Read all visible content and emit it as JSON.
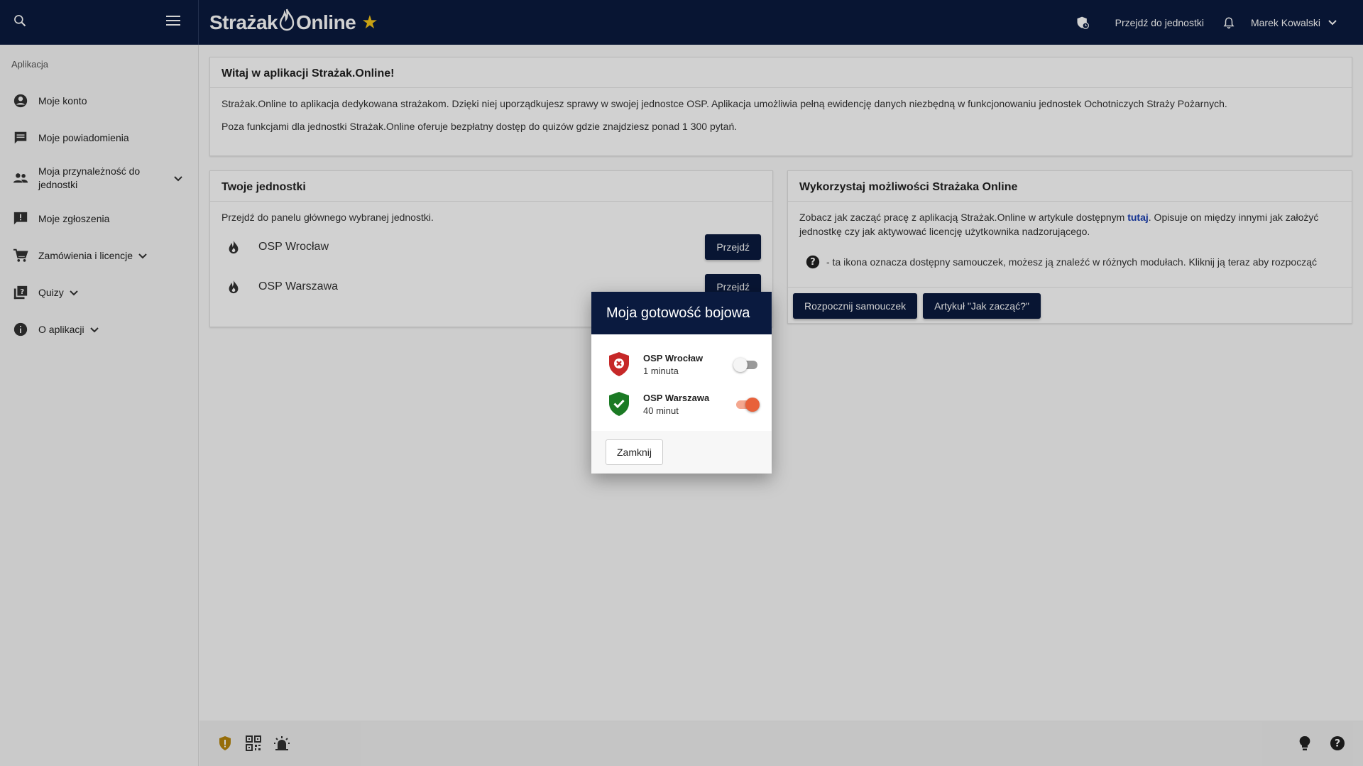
{
  "topbar": {
    "brand_left": "Strażak",
    "brand_right": "Online",
    "link_label": "Przejdź do jednostki",
    "user_name": "Marek Kowalski"
  },
  "sidebar": {
    "header": "Aplikacja",
    "items": [
      {
        "label": "Moje konto",
        "icon": "account-circle-icon"
      },
      {
        "label": "Moje powiadomienia",
        "icon": "message-icon"
      },
      {
        "label": "Moja przynależność do jednostki",
        "icon": "group-icon"
      },
      {
        "label": "Moje zgłoszenia",
        "icon": "report-icon"
      },
      {
        "label": "Zamówienia i licencje",
        "icon": "cart-icon"
      },
      {
        "label": "Quizy",
        "icon": "quiz-icon"
      },
      {
        "label": "O aplikacji",
        "icon": "info-icon"
      }
    ]
  },
  "welcome": {
    "title": "Witaj w aplikacji Strażak.Online!",
    "p1": "Strażak.Online to aplikacja dedykowana strażakom. Dzięki niej uporządkujesz sprawy w swojej jednostce OSP. Aplikacja umożliwia pełną ewidencję danych niezbędną w funkcjonowaniu jednostek Ochotniczych Straży Pożarnych.",
    "p2": "Poza funkcjami dla jednostki Strażak.Online oferuje bezpłatny dostęp do quizów gdzie znajdziesz ponad 1 300 pytań."
  },
  "units": {
    "title": "Twoje jednostki",
    "subtitle": "Przejdź do panelu głównego wybranej jednostki.",
    "list": [
      {
        "name": "OSP Wrocław",
        "button": "Przejdź"
      },
      {
        "name": "OSP Warszawa",
        "button": "Przejdź"
      }
    ]
  },
  "features": {
    "title": "Wykorzystaj możliwości Strażaka Online",
    "text_before": "Zobacz jak zacząć pracę z aplikacją Strażak.Online w artykule dostępnym ",
    "link": "tutaj",
    "text_after": ". Opisuje on między innymi jak założyć jednostkę czy jak aktywować licencję użytkownika nadzorującego.",
    "tutorial_hint": "- ta ikona oznacza dostępny samouczek, możesz ją znaleźć w różnych modułach. Kliknij ją teraz aby rozpocząć",
    "btn_tutorial": "Rozpocznij samouczek",
    "btn_article": "Artykuł \"Jak zacząć?\""
  },
  "modal": {
    "title": "Moja gotowość bojowa",
    "rows": [
      {
        "unit": "OSP Wrocław",
        "time": "1 minuta",
        "ready": false
      },
      {
        "unit": "OSP Warszawa",
        "time": "40 minut",
        "ready": true
      }
    ],
    "close": "Zamknij"
  },
  "colors": {
    "navy": "#0a1a3f",
    "accent": "#e8613a",
    "shield_red": "#c62828",
    "shield_green": "#1b7a24",
    "star": "#f5c518"
  }
}
